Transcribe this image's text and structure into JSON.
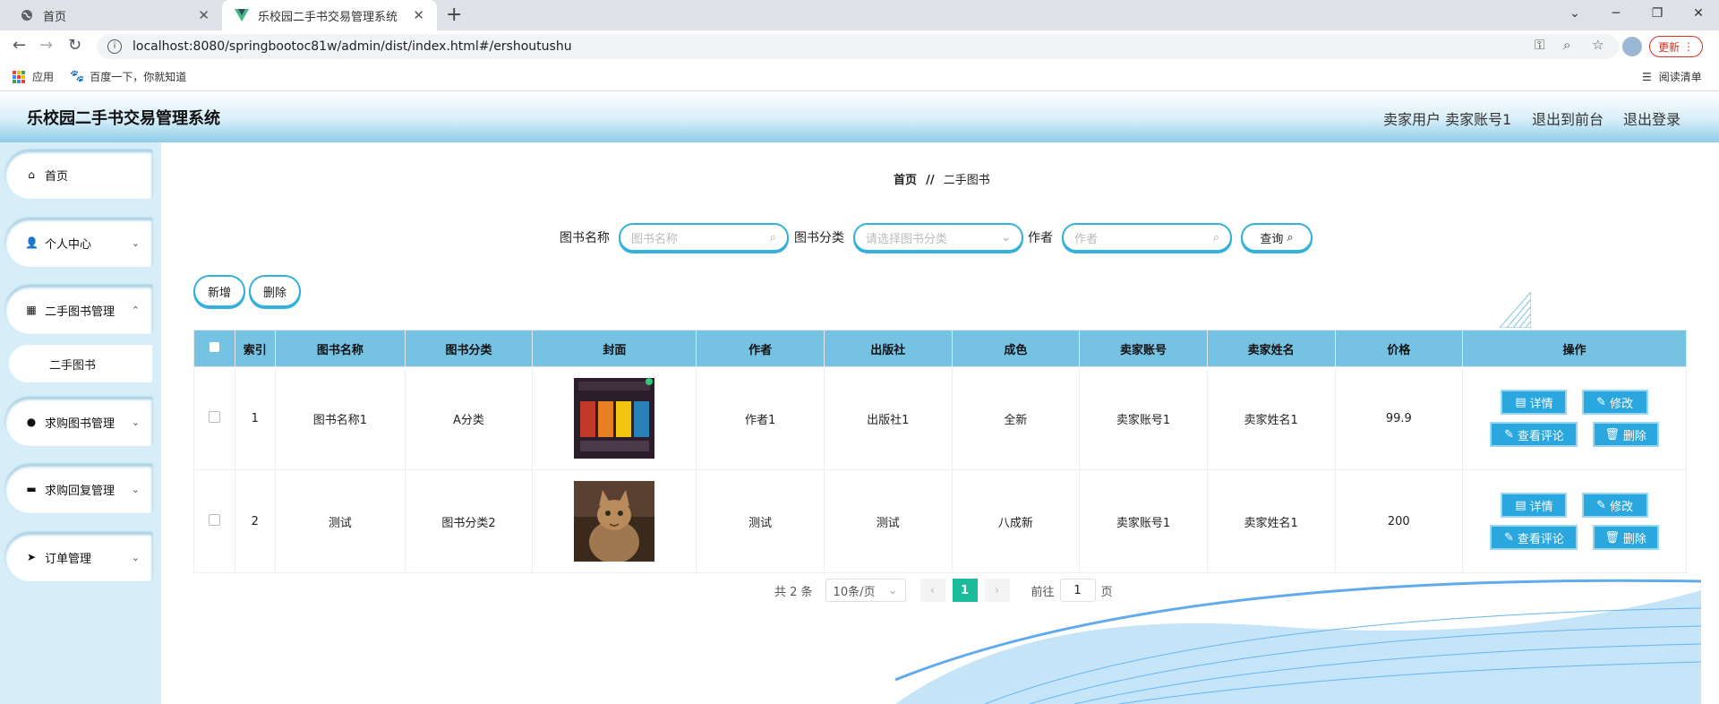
{
  "browser": {
    "tabs": [
      {
        "title": "首页"
      },
      {
        "title": "乐校园二手书交易管理系统"
      }
    ],
    "url": "localhost:8080/springbootoc81w/admin/dist/index.html#/ershoutushu",
    "update_label": "更新",
    "bookmarks": [
      {
        "label": "应用"
      },
      {
        "label": "百度一下，你就知道"
      }
    ],
    "reading_list": "阅读清单"
  },
  "header": {
    "title": "乐校园二手书交易管理系统",
    "user": "卖家用户 卖家账号1",
    "back_front": "退出到前台",
    "logout": "退出登录"
  },
  "sidebar": {
    "items": [
      {
        "label": "首页",
        "icon": "home-icon"
      },
      {
        "label": "个人中心",
        "icon": "user-icon"
      },
      {
        "label": "二手图书管理",
        "icon": "grid-icon"
      },
      {
        "label": "求购图书管理",
        "icon": "pin-icon"
      },
      {
        "label": "求购回复管理",
        "icon": "monitor-icon"
      },
      {
        "label": "订单管理",
        "icon": "send-icon"
      }
    ],
    "sub_item": "二手图书"
  },
  "breadcrumb": {
    "home": "首页",
    "sep": "//",
    "current": "二手图书"
  },
  "search": {
    "name_label": "图书名称",
    "name_placeholder": "图书名称",
    "category_label": "图书分类",
    "category_placeholder": "请选择图书分类",
    "author_label": "作者",
    "author_placeholder": "作者",
    "query_button": "查询"
  },
  "actions": {
    "add": "新增",
    "delete": "删除"
  },
  "table": {
    "headers": [
      "索引",
      "图书名称",
      "图书分类",
      "封面",
      "作者",
      "出版社",
      "成色",
      "卖家账号",
      "卖家姓名",
      "价格",
      "操作"
    ],
    "rows": [
      {
        "index": "1",
        "name": "图书名称1",
        "category": "A分类",
        "author": "作者1",
        "publisher": "出版社1",
        "condition": "全新",
        "seller_account": "卖家账号1",
        "seller_name": "卖家姓名1",
        "price": "99.9"
      },
      {
        "index": "2",
        "name": "测试",
        "category": "图书分类2",
        "author": "测试",
        "publisher": "测试",
        "condition": "八成新",
        "seller_account": "卖家账号1",
        "seller_name": "卖家姓名1",
        "price": "200"
      }
    ],
    "ops": {
      "detail": "详情",
      "edit": "修改",
      "comments": "查看评论",
      "delete": "删除"
    }
  },
  "pagination": {
    "total": "共 2 条",
    "page_size": "10条/页",
    "current_page": "1",
    "goto_label": "前往",
    "goto_value": "1",
    "page_suffix": "页"
  },
  "colors": {
    "accent": "#2ba7e0",
    "header_blue": "#76c2e3",
    "sidebar_bg": "#d7eef8",
    "page_active": "#1abc9c"
  }
}
